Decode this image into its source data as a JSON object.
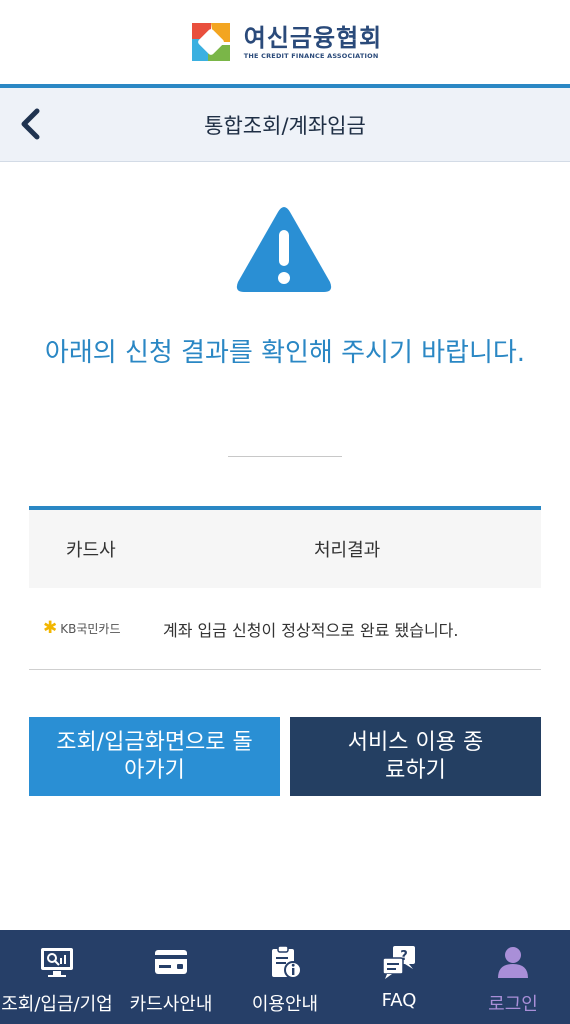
{
  "logo": {
    "title": "여신금융협회",
    "subtitle": "THE CREDIT FINANCE ASSOCIATION"
  },
  "header": {
    "title": "통합조회/계좌입금",
    "back_icon": "chevron-left-icon"
  },
  "alert": {
    "icon": "warning-triangle-icon",
    "message": "아래의 신청 결과를 확인해 주시기 바랍니다."
  },
  "table": {
    "columns": [
      "카드사",
      "처리결과"
    ],
    "rows": [
      {
        "card_company": "KB국민카드",
        "result": "계좌 입금 신청이 정상적으로 완료 됐습니다."
      }
    ]
  },
  "buttons": {
    "back_label": "조회/입금화면으로 돌아가기",
    "end_label": "서비스 이용 종료하기"
  },
  "nav": {
    "items": [
      {
        "label": "조회/입금/기업",
        "icon": "search-monitor-icon"
      },
      {
        "label": "카드사안내",
        "icon": "card-icon"
      },
      {
        "label": "이용안내",
        "icon": "clipboard-info-icon"
      },
      {
        "label": "FAQ",
        "icon": "faq-chat-icon"
      },
      {
        "label": "로그인",
        "icon": "user-icon"
      }
    ]
  },
  "colors": {
    "accent": "#2a87c4",
    "navy": "#263f68",
    "button_dark": "#243f62",
    "active_nav": "#a98fd8",
    "kb_yellow": "#f2b600"
  }
}
